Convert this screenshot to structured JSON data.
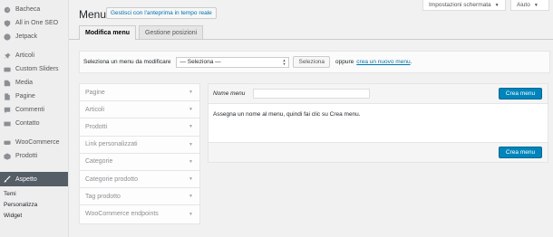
{
  "sidebar": {
    "items": [
      {
        "label": "Bacheca",
        "icon": "dashboard-icon"
      },
      {
        "label": "All in One SEO",
        "icon": "seo-icon"
      },
      {
        "label": "Jetpack",
        "icon": "jetpack-icon"
      },
      {
        "label": "Articoli",
        "icon": "pin-icon"
      },
      {
        "label": "Custom Sliders",
        "icon": "slider-icon"
      },
      {
        "label": "Media",
        "icon": "media-icon"
      },
      {
        "label": "Pagine",
        "icon": "pages-icon"
      },
      {
        "label": "Commenti",
        "icon": "comments-icon"
      },
      {
        "label": "Contatto",
        "icon": "contact-icon"
      },
      {
        "label": "WooCommerce",
        "icon": "woocommerce-icon"
      },
      {
        "label": "Prodotti",
        "icon": "products-icon"
      },
      {
        "label": "Aspetto",
        "icon": "appearance-icon"
      }
    ],
    "submenu": [
      "Temi",
      "Personalizza",
      "Widget"
    ]
  },
  "top": {
    "screen_options": "Impostazioni schermata",
    "help": "Aiuto"
  },
  "header": {
    "title": "Menu",
    "preview_button": "Gestisci con l'anteprima in tempo reale"
  },
  "tabs": [
    "Modifica menu",
    "Gestione posizioni"
  ],
  "select_bar": {
    "label": "Seleziona un menu da modificare",
    "dropdown_value": "— Seleziona —",
    "select_button": "Seleziona",
    "or_text": "oppure",
    "create_link": "crea un nuovo menu",
    "period": "."
  },
  "accordion": [
    "Pagine",
    "Articoli",
    "Prodotti",
    "Link personalizzati",
    "Categorie",
    "Categorie prodotto",
    "Tag prodotto",
    "WooCommerce endpoints"
  ],
  "menu_panel": {
    "name_label": "Nome menu",
    "name_value": "",
    "create_button": "Crea menu",
    "instructions": "Assegna un nome al menu, quindi fai clic su Crea menu.",
    "create_button_bottom": "Crea menu"
  },
  "colors": {
    "primary": "#0085ba",
    "active_menu": "#555d66",
    "link": "#0073aa"
  }
}
